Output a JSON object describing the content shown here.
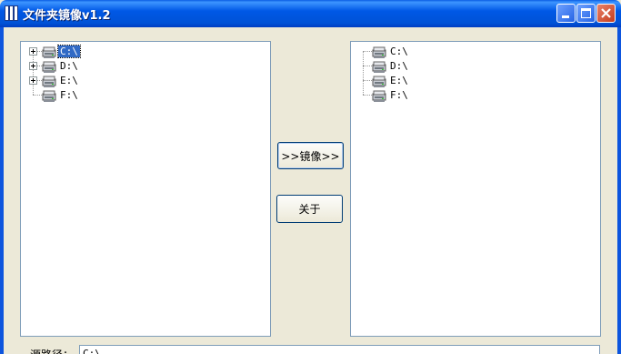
{
  "window": {
    "title": "文件夹镜像v1.2"
  },
  "left_tree": {
    "items": [
      {
        "label": "C:\\",
        "expandable": true,
        "selected": true
      },
      {
        "label": "D:\\",
        "expandable": true,
        "selected": false
      },
      {
        "label": "E:\\",
        "expandable": true,
        "selected": false
      },
      {
        "label": "F:\\",
        "expandable": false,
        "selected": false
      }
    ]
  },
  "right_tree": {
    "items": [
      {
        "label": "C:\\"
      },
      {
        "label": "D:\\"
      },
      {
        "label": "E:\\"
      },
      {
        "label": "F:\\"
      }
    ]
  },
  "buttons": {
    "mirror_label": ">>镜像>>",
    "about_label": "关于"
  },
  "source": {
    "label": "源路径：",
    "value": "C:\\"
  },
  "colors": {
    "titlebar": "#0058e6",
    "selection": "#316ac5",
    "close": "#c43d1e"
  },
  "icons": [
    "app-icon",
    "minimize-icon",
    "maximize-icon",
    "close-icon",
    "drive-icon",
    "expand-plus-icon"
  ]
}
